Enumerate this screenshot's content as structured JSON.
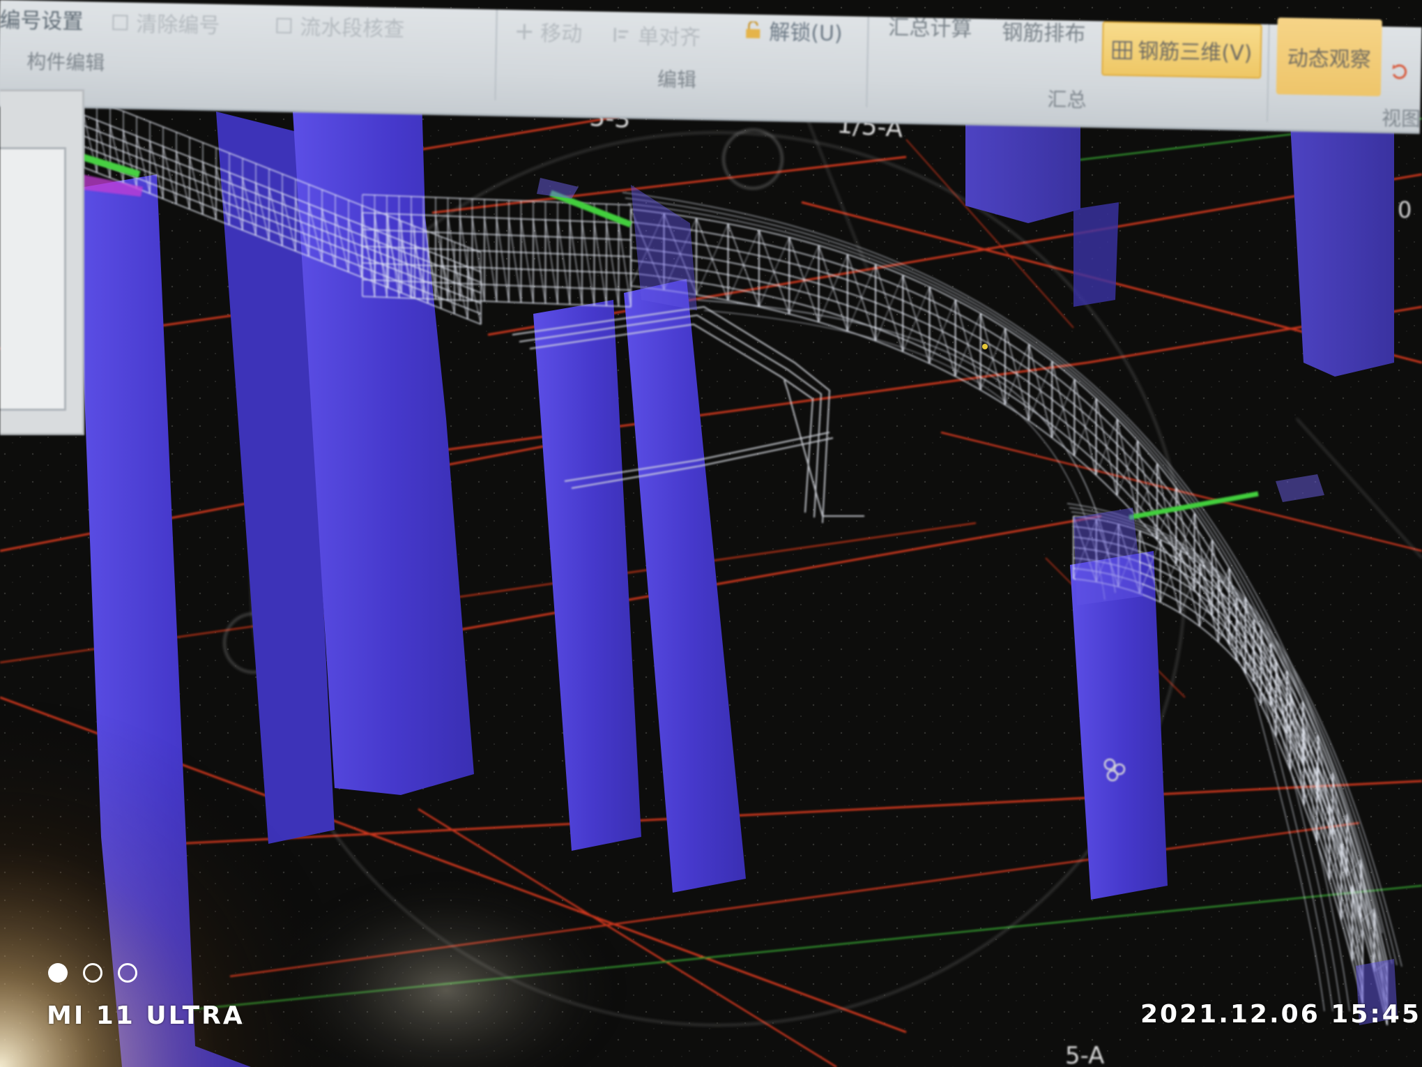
{
  "ribbon": {
    "number_settings": "编号设置",
    "clear_numbering": "清除编号",
    "flow_check": "流水段核查",
    "component_edit_group": "构件编辑",
    "move": "移动",
    "single_align": "单对齐",
    "unlock": "解锁(U)",
    "edit_group": "编辑",
    "summary_calc": "汇总计算",
    "rebar_layout": "钢筋排布",
    "rebar_3d": "钢筋三维(V)",
    "summary_group": "汇总",
    "dynamic_observe": "动态观察",
    "view_group": "视图"
  },
  "viewport": {
    "axis_labels": [
      "5-3",
      "1/5-A",
      "5-A"
    ],
    "edge_value": "0"
  },
  "camera_overlay": {
    "device": "MI 11 ULTRA",
    "timestamp": "2021.12.06 15:45"
  },
  "colors": {
    "column": "#4a3fd0",
    "grid_red": "#d33a1e",
    "grid_green": "#2c7a2a",
    "rebar": "#e8ecf6",
    "highlight_green": "#3bd34a",
    "active_button": "#f3cf73"
  },
  "icons": {
    "move": "move-icon",
    "single_align": "align-icon",
    "unlock": "lock-icon",
    "rebar_3d": "rebar-grid-icon",
    "view_cube": "view-cube-icon"
  }
}
